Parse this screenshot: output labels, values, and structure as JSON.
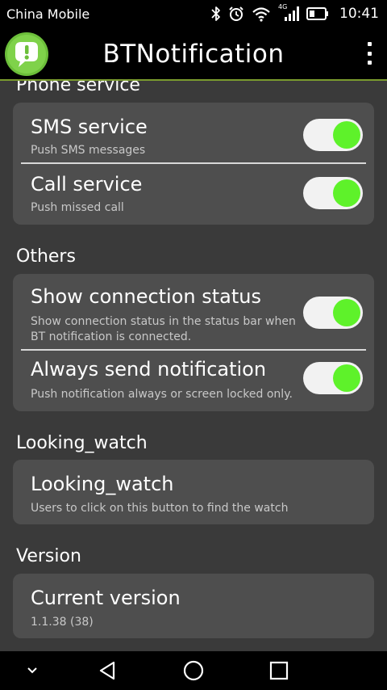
{
  "status_bar": {
    "carrier": "China Mobile",
    "time": "10:41",
    "network_label": "4G"
  },
  "app_bar": {
    "title": "BTNotification"
  },
  "sections": {
    "phone_service": {
      "header": "Phone service",
      "sms": {
        "title": "SMS service",
        "subtitle": "Push SMS messages",
        "enabled": true
      },
      "call": {
        "title": "Call service",
        "subtitle": "Push missed call",
        "enabled": true
      }
    },
    "others": {
      "header": "Others",
      "connection_status": {
        "title": "Show connection status",
        "subtitle_line1": "Show connection status in the status bar when",
        "subtitle_line2": "BT notification is connected.",
        "enabled": true
      },
      "always_send": {
        "title": "Always send notification",
        "subtitle": "Push notification always or screen locked only.",
        "enabled": true
      }
    },
    "looking_watch": {
      "header": "Looking_watch",
      "item": {
        "title": "Looking_watch",
        "subtitle": "Users to click on this button to find the watch"
      }
    },
    "version": {
      "header": "Version",
      "item": {
        "title": "Current version",
        "subtitle": "1.1.38 (38)"
      }
    }
  },
  "colors": {
    "toggle_on": "#5ef22a",
    "card_bg": "#4e4e4e",
    "screen_bg": "#3a3a3a",
    "app_bar_accent": "#7a9b2e"
  },
  "icons": {
    "logo": "exclamation-bubble-icon",
    "bluetooth": "bluetooth-icon",
    "alarm": "alarm-icon",
    "wifi": "wifi-icon",
    "signal": "signal-icon",
    "battery": "battery-icon",
    "menu": "overflow-menu-icon",
    "nav_down": "chevron-down-icon",
    "nav_back": "back-triangle-icon",
    "nav_home": "home-circle-icon",
    "nav_recents": "recents-square-icon"
  }
}
